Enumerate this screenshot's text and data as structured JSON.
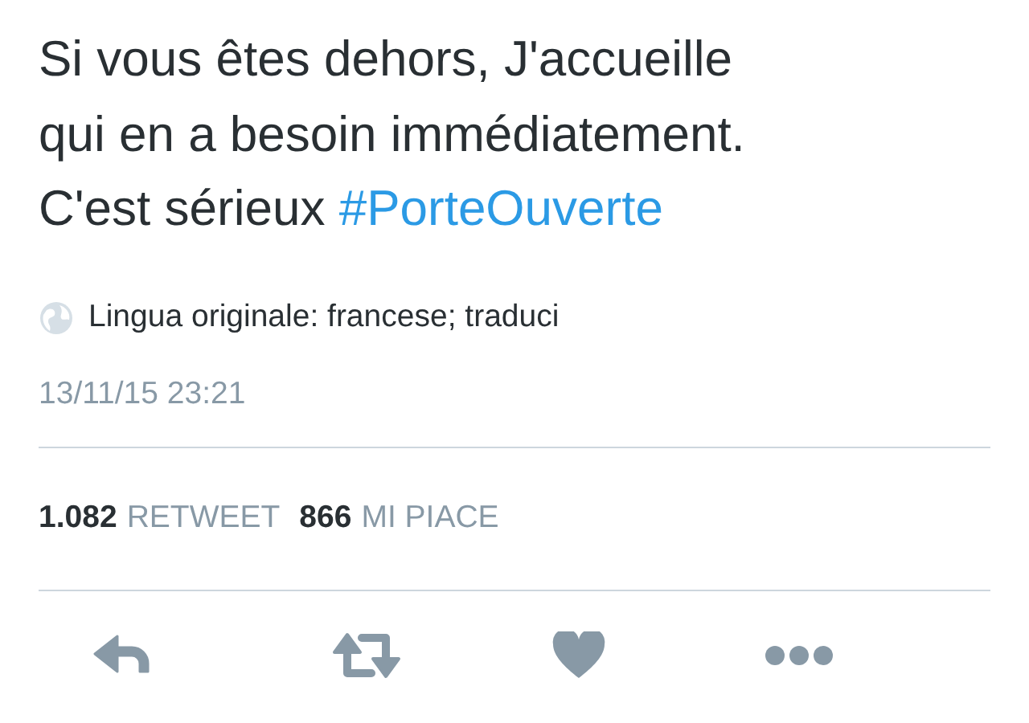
{
  "tweet": {
    "lines": [
      "Si vous êtes dehors, J'accueille",
      "qui en a besoin immédiatement.",
      "C'est sérieux"
    ],
    "hashtag": "#PorteOuverte"
  },
  "translation": {
    "text": "Lingua originale: francese; traduci"
  },
  "timestamp": "13/11/15 23:21",
  "stats": [
    {
      "count": "1.082",
      "label": "RETWEET"
    },
    {
      "count": "866",
      "label": "MI PIACE"
    }
  ],
  "actions": [
    {
      "kind": "reply"
    },
    {
      "kind": "retweet"
    },
    {
      "kind": "like"
    },
    {
      "kind": "more"
    }
  ]
}
